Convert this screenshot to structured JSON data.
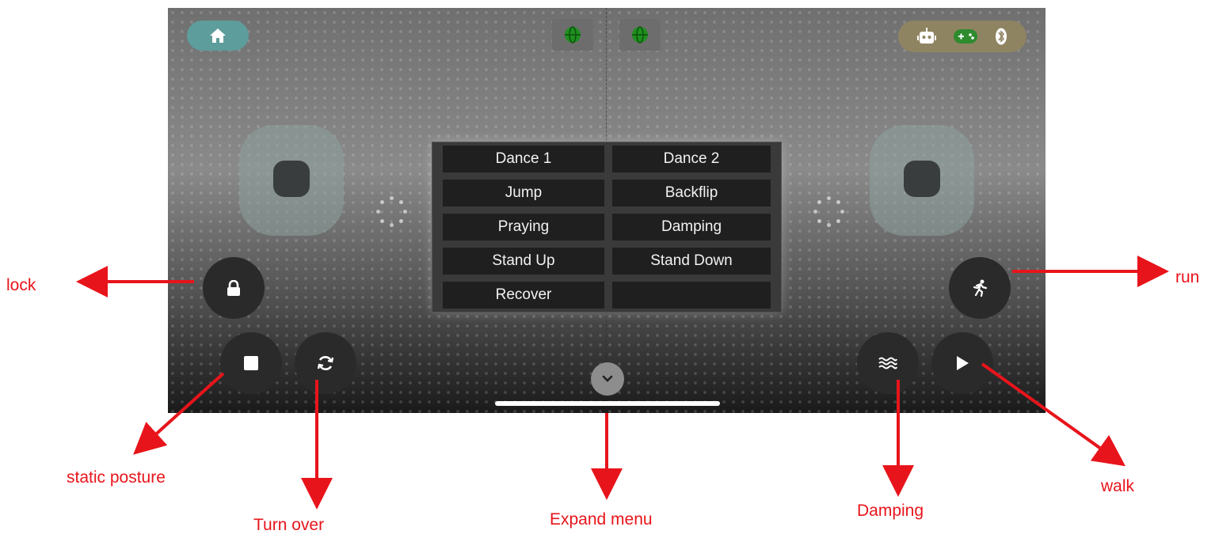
{
  "menu": {
    "items": [
      "Dance 1",
      "Dance 2",
      "Jump",
      "Backflip",
      "Praying",
      "Damping",
      "Stand Up",
      "Stand Down",
      "Recover",
      ""
    ]
  },
  "icons": {
    "home": "home-icon",
    "globe": "globe-icon",
    "robot": "robot-icon",
    "gamepad": "gamepad-icon",
    "bluetooth": "bluetooth-icon",
    "lock": "lock-icon",
    "stop": "stop-icon",
    "refresh": "refresh-icon",
    "chevron": "chevron-down-icon",
    "waves": "waves-icon",
    "play": "play-icon",
    "run": "running-person-icon"
  },
  "annotations": {
    "lock": "lock",
    "static_posture": "static posture",
    "turn_over": "Turn over",
    "expand_menu": "Expand menu",
    "damping": "Damping",
    "walk": "walk",
    "run": "run"
  },
  "colors": {
    "annotation": "#e8141b",
    "home_pill": "#5d9d9c",
    "status_pill": "#8f8462",
    "globe": "#1f8f1f"
  }
}
